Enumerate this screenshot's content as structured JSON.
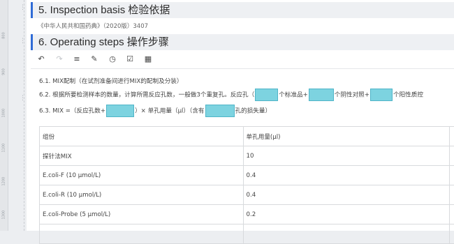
{
  "ruler": {
    "ticks": [
      "800",
      "900",
      "1000",
      "1100",
      "1200",
      "1300"
    ]
  },
  "sections": {
    "inspection_basis": {
      "title": "5. Inspection basis 检验依据",
      "reference": "《中华人民共和国药典》（2020版）3407"
    },
    "operating_steps": {
      "title": "6.  Operating steps 操作步骤"
    }
  },
  "toolbar": {
    "undo": "undo-icon",
    "redo": "redo-icon",
    "list": "list-icon",
    "edit": "pencil-icon",
    "history": "clock-icon",
    "check": "checkbox-icon",
    "table": "table-icon"
  },
  "steps": {
    "s1": "6.1. MIX配制（在试剂准备间进行MIX的配制及分装）",
    "s2_a": "6.2. 根据所要检测样本的数量，计算所需反应孔数，一般做3个重复孔。反应孔（",
    "s2_b": "个标准品+",
    "s2_c": "个阴性对照+",
    "s2_d": "个阳性质控",
    "s3_a": "6.3. MIX =（反应孔数+",
    "s3_b": "）× 单孔用量（μl）（含有",
    "s3_c": "孔的损失量）"
  },
  "table": {
    "header": [
      "组份",
      "单孔用量(μl)"
    ],
    "rows": [
      [
        "探针法MIX",
        "10"
      ],
      [
        "E.coli-F (10 μmol/L)",
        "0.4"
      ],
      [
        "E.coli-R (10 μmol/L)",
        "0.4"
      ],
      [
        "E.coli-Probe (5 μmol/L)",
        "0.2"
      ],
      [
        "",
        ""
      ]
    ]
  },
  "colors": {
    "accent": "#2f6bd6",
    "input_fill": "#7dd3e0"
  }
}
